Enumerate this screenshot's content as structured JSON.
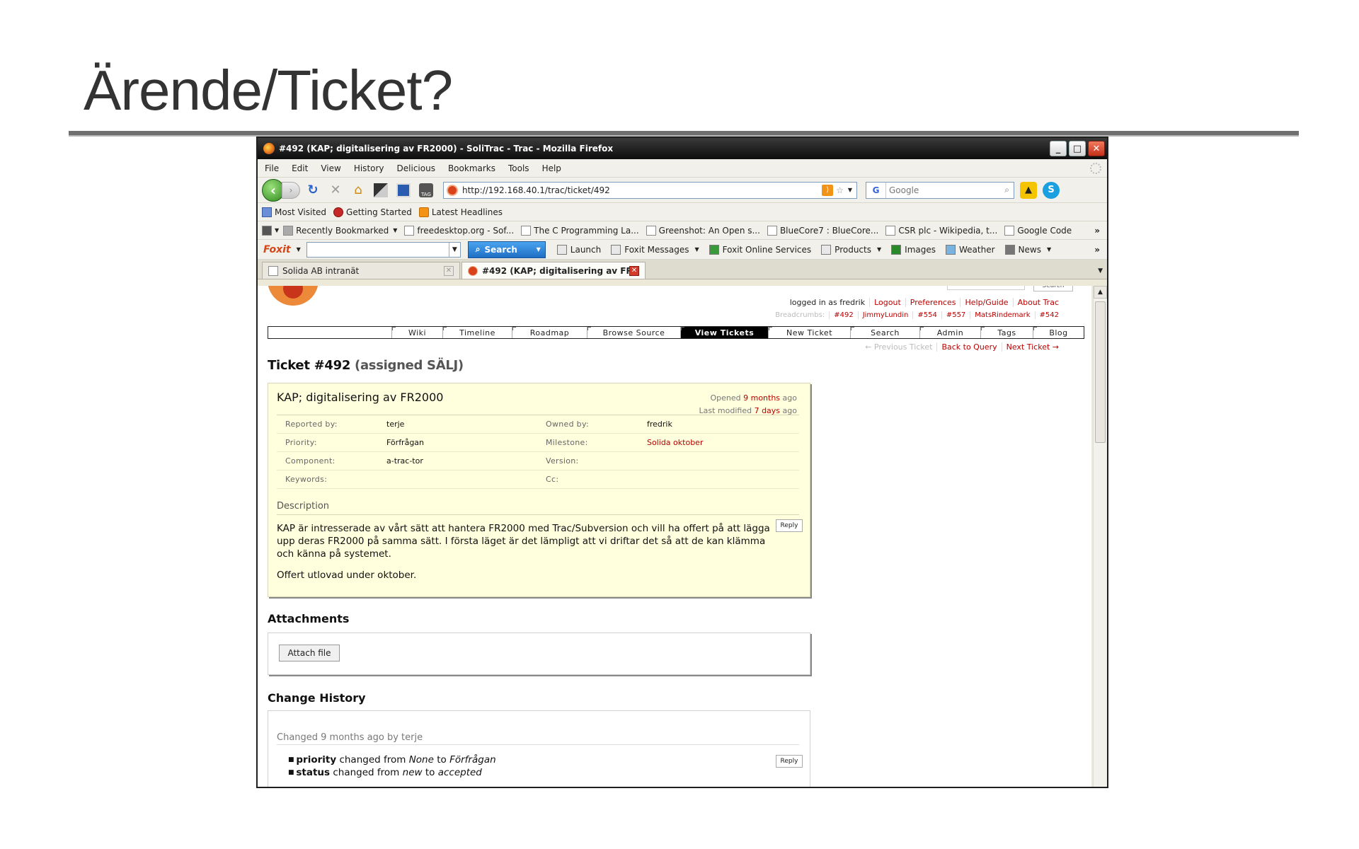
{
  "slide": {
    "title": "Ärende/Ticket?"
  },
  "window": {
    "title": "#492 (KAP; digitalisering av FR2000) - SoliTrac - Trac - Mozilla Firefox",
    "minimize": "_",
    "maximize": "□",
    "close": "✕"
  },
  "menu": [
    "File",
    "Edit",
    "View",
    "History",
    "Delicious",
    "Bookmarks",
    "Tools",
    "Help"
  ],
  "nav": {
    "url": "http://192.168.40.1/trac/ticket/492",
    "search_placeholder": "Google",
    "search_engine_icon": "G"
  },
  "bookmarks_row1": [
    "Most Visited",
    "Getting Started",
    "Latest Headlines"
  ],
  "bookmarks_row2": [
    "Recently Bookmarked",
    "freedesktop.org - Sof...",
    "The C Programming La...",
    "Greenshot: An Open s...",
    "BlueCore7 : BlueCore...",
    "CSR plc - Wikipedia, t...",
    "Google Code"
  ],
  "foxit": {
    "brand": "Foxit",
    "search_label": "Search",
    "items": [
      "Launch",
      "Foxit Messages",
      "Foxit Online Services",
      "Products",
      "Images",
      "Weather",
      "News"
    ]
  },
  "tabs": [
    {
      "label": "Solida AB intranät",
      "active": false
    },
    {
      "label": "#492 (KAP; digitalisering av FR20...",
      "active": true
    }
  ],
  "trac": {
    "search_button": "Search",
    "metanav": [
      "logged in as fredrik",
      "Logout",
      "Preferences",
      "Help/Guide",
      "About Trac"
    ],
    "breadcrumbs": [
      "Breadcrumbs:",
      "#492",
      "JimmyLundin",
      "#554",
      "#557",
      "MatsRindemark",
      "#542"
    ],
    "mainnav": [
      "Wiki",
      "Timeline",
      "Roadmap",
      "Browse Source",
      "View Tickets",
      "New Ticket",
      "Search",
      "Admin",
      "Tags",
      "Blog"
    ],
    "mainnav_active": "View Tickets",
    "ctxnav": [
      "← Previous Ticket",
      "Back to Query",
      "Next Ticket →"
    ],
    "ticket": {
      "heading": "Ticket #492",
      "status": "(assigned SÄLJ)",
      "summary": "KAP; digitalisering av FR2000",
      "opened_prefix": "Opened",
      "opened": "9 months",
      "opened_suffix": "ago",
      "modified_prefix": "Last modified",
      "modified": "7 days",
      "modified_suffix": "ago",
      "props": [
        {
          "k1": "Reported by:",
          "v1": "terje",
          "k2": "Owned by:",
          "v2": "fredrik"
        },
        {
          "k1": "Priority:",
          "v1": "Förfrågan",
          "k2": "Milestone:",
          "v2": "Solida oktober"
        },
        {
          "k1": "Component:",
          "v1": "a-trac-tor",
          "k2": "Version:",
          "v2": ""
        },
        {
          "k1": "Keywords:",
          "v1": "",
          "k2": "Cc:",
          "v2": ""
        }
      ],
      "description_label": "Description",
      "description_p1": "KAP är intresserade av vårt sätt att hantera FR2000 med Trac/Subversion och vill ha offert på att lägga upp deras FR2000 på samma sätt. I första läget är det lämpligt att vi driftar det så att de kan klämma och känna på systemet.",
      "description_p2": "Offert utlovad under oktober.",
      "reply": "Reply"
    },
    "attachments": {
      "heading": "Attachments",
      "button": "Attach file"
    },
    "history": {
      "heading": "Change History",
      "meta": "Changed 9 months ago by terje",
      "changes": [
        {
          "field": "priority",
          "verb": "changed from",
          "from": "None",
          "to_word": "to",
          "to": "Förfrågan"
        },
        {
          "field": "status",
          "verb": "changed from",
          "from": "new",
          "to_word": "to",
          "to": "accepted"
        }
      ],
      "reply": "Reply"
    }
  }
}
